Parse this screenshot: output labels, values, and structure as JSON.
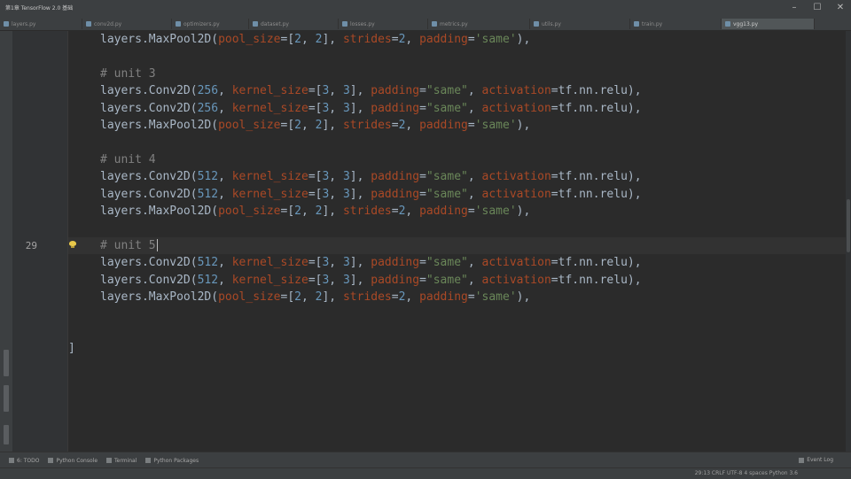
{
  "window": {
    "title": "第1章 TensorFlow 2.0 基础",
    "controls": [
      "–",
      "☐",
      "✕"
    ]
  },
  "tabs": [
    {
      "label": "layers.py",
      "icon": "python-file-icon",
      "active": false
    },
    {
      "label": "conv2d.py",
      "icon": "python-file-icon",
      "active": false
    },
    {
      "label": "optimizers.py",
      "icon": "python-file-icon",
      "active": false
    },
    {
      "label": "dataset.py",
      "icon": "python-file-icon",
      "active": false
    },
    {
      "label": "losses.py",
      "icon": "python-file-icon",
      "active": false
    },
    {
      "label": "metrics.py",
      "icon": "python-file-icon",
      "active": false
    },
    {
      "label": "utils.py",
      "icon": "python-file-icon",
      "active": false
    },
    {
      "label": "train.py",
      "icon": "python-file-icon",
      "active": false
    },
    {
      "label": "vgg13.py",
      "icon": "python-file-icon",
      "active": true
    }
  ],
  "editor": {
    "current_line": "29",
    "line_numbers": [
      "",
      "",
      "",
      "",
      "",
      "",
      "",
      "",
      "",
      "",
      "",
      "",
      "29",
      "",
      "",
      "",
      "",
      "",
      "",
      ""
    ],
    "closing_bracket": "]",
    "lines": [
      {
        "tokens": [
          {
            "t": "layers.MaxPool2D(",
            "c": ""
          },
          {
            "t": "pool_size",
            "c": "kw"
          },
          {
            "t": "=[",
            "c": ""
          },
          {
            "t": "2",
            "c": "num"
          },
          {
            "t": ", ",
            "c": ""
          },
          {
            "t": "2",
            "c": "num"
          },
          {
            "t": "], ",
            "c": ""
          },
          {
            "t": "strides",
            "c": "kw"
          },
          {
            "t": "=",
            "c": ""
          },
          {
            "t": "2",
            "c": "num"
          },
          {
            "t": ", ",
            "c": ""
          },
          {
            "t": "padding",
            "c": "kw"
          },
          {
            "t": "=",
            "c": ""
          },
          {
            "t": "'same'",
            "c": "str"
          },
          {
            "t": "),",
            "c": ""
          }
        ]
      },
      {
        "tokens": []
      },
      {
        "tokens": [
          {
            "t": "# unit 3",
            "c": "cmt"
          }
        ]
      },
      {
        "tokens": [
          {
            "t": "layers.Conv2D(",
            "c": ""
          },
          {
            "t": "256",
            "c": "num"
          },
          {
            "t": ", ",
            "c": ""
          },
          {
            "t": "kernel_size",
            "c": "kw"
          },
          {
            "t": "=[",
            "c": ""
          },
          {
            "t": "3",
            "c": "num"
          },
          {
            "t": ", ",
            "c": ""
          },
          {
            "t": "3",
            "c": "num"
          },
          {
            "t": "], ",
            "c": ""
          },
          {
            "t": "padding",
            "c": "kw"
          },
          {
            "t": "=",
            "c": ""
          },
          {
            "t": "\"same\"",
            "c": "str"
          },
          {
            "t": ", ",
            "c": ""
          },
          {
            "t": "activation",
            "c": "kw"
          },
          {
            "t": "=tf.nn.relu),",
            "c": ""
          }
        ]
      },
      {
        "tokens": [
          {
            "t": "layers.Conv2D(",
            "c": ""
          },
          {
            "t": "256",
            "c": "num"
          },
          {
            "t": ", ",
            "c": ""
          },
          {
            "t": "kernel_size",
            "c": "kw"
          },
          {
            "t": "=[",
            "c": ""
          },
          {
            "t": "3",
            "c": "num"
          },
          {
            "t": ", ",
            "c": ""
          },
          {
            "t": "3",
            "c": "num"
          },
          {
            "t": "], ",
            "c": ""
          },
          {
            "t": "padding",
            "c": "kw"
          },
          {
            "t": "=",
            "c": ""
          },
          {
            "t": "\"same\"",
            "c": "str"
          },
          {
            "t": ", ",
            "c": ""
          },
          {
            "t": "activation",
            "c": "kw"
          },
          {
            "t": "=tf.nn.relu),",
            "c": ""
          }
        ]
      },
      {
        "tokens": [
          {
            "t": "layers.MaxPool2D(",
            "c": ""
          },
          {
            "t": "pool_size",
            "c": "kw"
          },
          {
            "t": "=[",
            "c": ""
          },
          {
            "t": "2",
            "c": "num"
          },
          {
            "t": ", ",
            "c": ""
          },
          {
            "t": "2",
            "c": "num"
          },
          {
            "t": "], ",
            "c": ""
          },
          {
            "t": "strides",
            "c": "kw"
          },
          {
            "t": "=",
            "c": ""
          },
          {
            "t": "2",
            "c": "num"
          },
          {
            "t": ", ",
            "c": ""
          },
          {
            "t": "padding",
            "c": "kw"
          },
          {
            "t": "=",
            "c": ""
          },
          {
            "t": "'same'",
            "c": "str"
          },
          {
            "t": "),",
            "c": ""
          }
        ]
      },
      {
        "tokens": []
      },
      {
        "tokens": [
          {
            "t": "# unit 4",
            "c": "cmt"
          }
        ]
      },
      {
        "tokens": [
          {
            "t": "layers.Conv2D(",
            "c": ""
          },
          {
            "t": "512",
            "c": "num"
          },
          {
            "t": ", ",
            "c": ""
          },
          {
            "t": "kernel_size",
            "c": "kw"
          },
          {
            "t": "=[",
            "c": ""
          },
          {
            "t": "3",
            "c": "num"
          },
          {
            "t": ", ",
            "c": ""
          },
          {
            "t": "3",
            "c": "num"
          },
          {
            "t": "], ",
            "c": ""
          },
          {
            "t": "padding",
            "c": "kw"
          },
          {
            "t": "=",
            "c": ""
          },
          {
            "t": "\"same\"",
            "c": "str"
          },
          {
            "t": ", ",
            "c": ""
          },
          {
            "t": "activation",
            "c": "kw"
          },
          {
            "t": "=tf.nn.relu),",
            "c": ""
          }
        ]
      },
      {
        "tokens": [
          {
            "t": "layers.Conv2D(",
            "c": ""
          },
          {
            "t": "512",
            "c": "num"
          },
          {
            "t": ", ",
            "c": ""
          },
          {
            "t": "kernel_size",
            "c": "kw"
          },
          {
            "t": "=[",
            "c": ""
          },
          {
            "t": "3",
            "c": "num"
          },
          {
            "t": ", ",
            "c": ""
          },
          {
            "t": "3",
            "c": "num"
          },
          {
            "t": "], ",
            "c": ""
          },
          {
            "t": "padding",
            "c": "kw"
          },
          {
            "t": "=",
            "c": ""
          },
          {
            "t": "\"same\"",
            "c": "str"
          },
          {
            "t": ", ",
            "c": ""
          },
          {
            "t": "activation",
            "c": "kw"
          },
          {
            "t": "=tf.nn.relu),",
            "c": ""
          }
        ]
      },
      {
        "tokens": [
          {
            "t": "layers.MaxPool2D(",
            "c": ""
          },
          {
            "t": "pool_size",
            "c": "kw"
          },
          {
            "t": "=[",
            "c": ""
          },
          {
            "t": "2",
            "c": "num"
          },
          {
            "t": ", ",
            "c": ""
          },
          {
            "t": "2",
            "c": "num"
          },
          {
            "t": "], ",
            "c": ""
          },
          {
            "t": "strides",
            "c": "kw"
          },
          {
            "t": "=",
            "c": ""
          },
          {
            "t": "2",
            "c": "num"
          },
          {
            "t": ", ",
            "c": ""
          },
          {
            "t": "padding",
            "c": "kw"
          },
          {
            "t": "=",
            "c": ""
          },
          {
            "t": "'same'",
            "c": "str"
          },
          {
            "t": "),",
            "c": ""
          }
        ]
      },
      {
        "tokens": []
      },
      {
        "tokens": [
          {
            "t": "# unit 5",
            "c": "cmt"
          }
        ],
        "caret": true
      },
      {
        "tokens": [
          {
            "t": "layers.Conv2D(",
            "c": ""
          },
          {
            "t": "512",
            "c": "num"
          },
          {
            "t": ", ",
            "c": ""
          },
          {
            "t": "kernel_size",
            "c": "kw"
          },
          {
            "t": "=[",
            "c": ""
          },
          {
            "t": "3",
            "c": "num"
          },
          {
            "t": ", ",
            "c": ""
          },
          {
            "t": "3",
            "c": "num"
          },
          {
            "t": "], ",
            "c": ""
          },
          {
            "t": "padding",
            "c": "kw"
          },
          {
            "t": "=",
            "c": ""
          },
          {
            "t": "\"same\"",
            "c": "str"
          },
          {
            "t": ", ",
            "c": ""
          },
          {
            "t": "activation",
            "c": "kw"
          },
          {
            "t": "=tf.nn.relu),",
            "c": ""
          }
        ]
      },
      {
        "tokens": [
          {
            "t": "layers.Conv2D(",
            "c": ""
          },
          {
            "t": "512",
            "c": "num"
          },
          {
            "t": ", ",
            "c": ""
          },
          {
            "t": "kernel_size",
            "c": "kw"
          },
          {
            "t": "=[",
            "c": ""
          },
          {
            "t": "3",
            "c": "num"
          },
          {
            "t": ", ",
            "c": ""
          },
          {
            "t": "3",
            "c": "num"
          },
          {
            "t": "], ",
            "c": ""
          },
          {
            "t": "padding",
            "c": "kw"
          },
          {
            "t": "=",
            "c": ""
          },
          {
            "t": "\"same\"",
            "c": "str"
          },
          {
            "t": ", ",
            "c": ""
          },
          {
            "t": "activation",
            "c": "kw"
          },
          {
            "t": "=tf.nn.relu),",
            "c": ""
          }
        ]
      },
      {
        "tokens": [
          {
            "t": "layers.MaxPool2D(",
            "c": ""
          },
          {
            "t": "pool_size",
            "c": "kw"
          },
          {
            "t": "=[",
            "c": ""
          },
          {
            "t": "2",
            "c": "num"
          },
          {
            "t": ", ",
            "c": ""
          },
          {
            "t": "2",
            "c": "num"
          },
          {
            "t": "], ",
            "c": ""
          },
          {
            "t": "strides",
            "c": "kw"
          },
          {
            "t": "=",
            "c": ""
          },
          {
            "t": "2",
            "c": "num"
          },
          {
            "t": ", ",
            "c": ""
          },
          {
            "t": "padding",
            "c": "kw"
          },
          {
            "t": "=",
            "c": ""
          },
          {
            "t": "'same'",
            "c": "str"
          },
          {
            "t": "),",
            "c": ""
          }
        ]
      },
      {
        "tokens": []
      },
      {
        "tokens": []
      },
      {
        "tokens": []
      }
    ]
  },
  "tool_windows": [
    {
      "label": "6: TODO",
      "icon": "todo-icon"
    },
    {
      "label": "Python Console",
      "icon": "console-icon"
    },
    {
      "label": "Terminal",
      "icon": "terminal-icon"
    },
    {
      "label": "Python Packages",
      "icon": "packages-icon"
    }
  ],
  "event_log": "Event Log",
  "status": "29:13  CRLF  UTF-8  4 spaces  Python 3.6",
  "colors": {
    "background": "#2b2b2b",
    "keyword_arg": "#aa4926",
    "number": "#6897bb",
    "string": "#6a8759",
    "comment": "#808080"
  }
}
